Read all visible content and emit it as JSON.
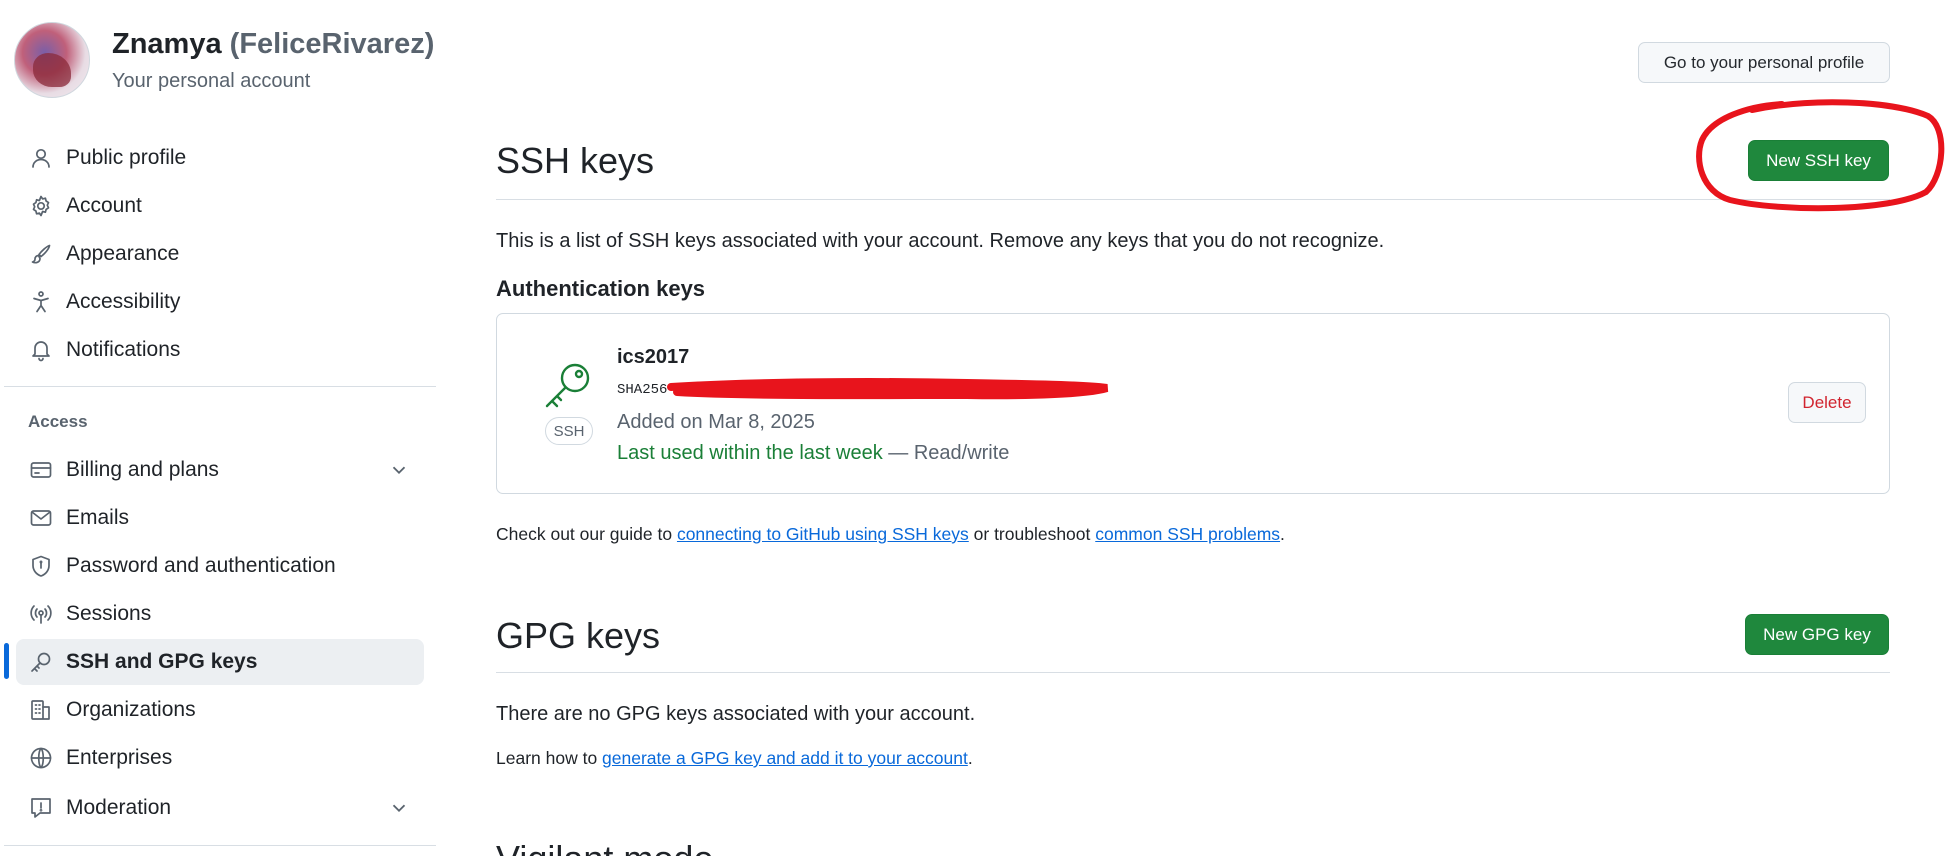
{
  "account": {
    "name": "Znamya",
    "login": "(FeliceRivarez)",
    "subtitle": "Your personal account",
    "profile_button": "Go to your personal profile"
  },
  "sidebar": {
    "items_top": [
      {
        "label": "Public profile",
        "icon": "person-icon"
      },
      {
        "label": "Account",
        "icon": "gear-icon"
      },
      {
        "label": "Appearance",
        "icon": "paintbrush-icon"
      },
      {
        "label": "Accessibility",
        "icon": "accessibility-icon"
      },
      {
        "label": "Notifications",
        "icon": "bell-icon"
      }
    ],
    "access_heading": "Access",
    "items_access": [
      {
        "label": "Billing and plans",
        "icon": "credit-card-icon",
        "expandable": true
      },
      {
        "label": "Emails",
        "icon": "mail-icon"
      },
      {
        "label": "Password and authentication",
        "icon": "shield-icon"
      },
      {
        "label": "Sessions",
        "icon": "broadcast-icon"
      },
      {
        "label": "SSH and GPG keys",
        "icon": "key-icon",
        "active": true
      },
      {
        "label": "Organizations",
        "icon": "organization-icon"
      },
      {
        "label": "Enterprises",
        "icon": "globe-icon"
      },
      {
        "label": "Moderation",
        "icon": "report-icon",
        "expandable": true
      }
    ]
  },
  "ssh": {
    "title": "SSH keys",
    "new_button": "New SSH key",
    "description": "This is a list of SSH keys associated with your account. Remove any keys that you do not recognize.",
    "auth_heading": "Authentication keys",
    "key": {
      "name": "ics2017",
      "fingerprint_prefix": "SHA256",
      "added": "Added on Mar 8, 2025",
      "last_used": "Last used within the last week",
      "access": "— Read/write",
      "badge": "SSH",
      "delete_button": "Delete"
    },
    "guide_prefix": "Check out our guide to ",
    "guide_link1": "connecting to GitHub using SSH keys",
    "guide_middle": " or troubleshoot ",
    "guide_link2": "common SSH problems",
    "guide_suffix": "."
  },
  "gpg": {
    "title": "GPG keys",
    "new_button": "New GPG key",
    "empty_text": "There are no GPG keys associated with your account.",
    "learn_prefix": "Learn how to ",
    "learn_link": "generate a GPG key and add it to your account",
    "learn_suffix": "."
  },
  "vigilant": {
    "title": "Vigilant mode"
  },
  "colors": {
    "primary_green": "#1f883d",
    "link_blue": "#0969da",
    "danger_red": "#d1242f",
    "annotation_red": "#e8141c",
    "active_indicator": "#0969da"
  }
}
